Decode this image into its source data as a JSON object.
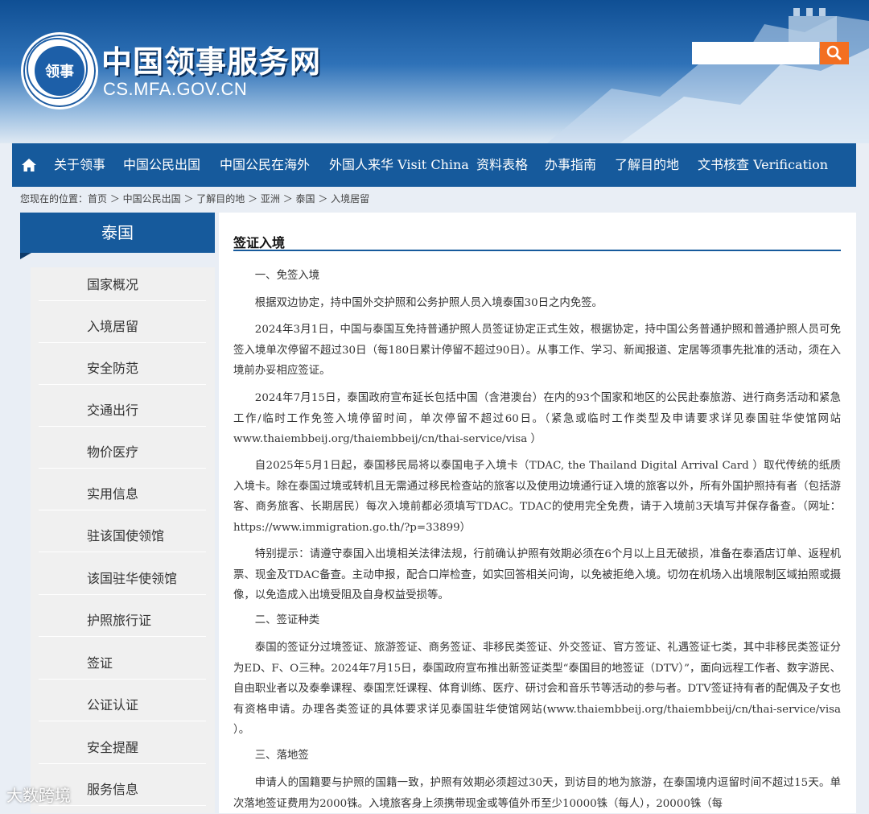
{
  "header": {
    "seal_text": "领事",
    "title": "中国领事服务网",
    "url": "CS.MFA.GOV.CN"
  },
  "nav": {
    "items": [
      "关于领事",
      "中国公民出国",
      "中国公民在海外",
      "外国人来华 Visit China",
      "资料表格",
      "办事指南",
      "了解目的地",
      "文书核查 Verification"
    ]
  },
  "breadcrumb": "您现在的位置：首页 ＞ 中国公民出国 ＞ 了解目的地 ＞ 亚洲 ＞ 泰国 ＞ 入境居留",
  "sidebar": {
    "title": "泰国",
    "items": [
      "国家概况",
      "入境居留",
      "安全防范",
      "交通出行",
      "物价医疗",
      "实用信息",
      "驻该国使领馆",
      "该国驻华使领馆",
      "护照旅行证",
      "签证",
      "公证认证",
      "安全提醒",
      "服务信息"
    ]
  },
  "content": {
    "title": "签证入境",
    "paragraphs": [
      "一、免签入境",
      "根据双边协定，持中国外交护照和公务护照人员入境泰国30日之内免签。",
      "2024年3月1日，中国与泰国互免持普通护照人员签证协定正式生效，根据协定，持中国公务普通护照和普通护照人员可免签入境单次停留不超过30日（每180日累计停留不超过90日）。从事工作、学习、新闻报道、定居等须事先批准的活动，须在入境前办妥相应签证。",
      "2024年7月15日，泰国政府宣布延长包括中国（含港澳台）在内的93个国家和地区的公民赴泰旅游、进行商务活动和紧急工作/临时工作免签入境停留时间，单次停留不超过60日。（紧急或临时工作类型及申请要求详见泰国驻华使馆网站www.thaiembbeij.org/thaiembbeij/cn/thai-service/visa ）",
      "自2025年5月1日起，泰国移民局将以泰国电子入境卡（TDAC, the Thailand Digital Arrival Card ）取代传统的纸质入境卡。除在泰国过境或转机且无需通过移民检查站的旅客以及使用边境通行证入境的旅客以外，所有外国护照持有者（包括游客、商务旅客、长期居民）每次入境前都必须填写TDAC。TDAC的使用完全免费，请于入境前3天填写并保存备查。（网址：https://www.immigration.go.th/?p=33899）",
      "特别提示：请遵守泰国入出境相关法律法规，行前确认护照有效期必须在6个月以上且无破损，准备在泰酒店订单、返程机票、现金及TDAC备查。主动申报，配合口岸检查，如实回答相关问询，以免被拒绝入境。切勿在机场入出境限制区域拍照或摄像，以免造成入出境受阻及自身权益受损等。",
      "二、签证种类",
      "泰国的签证分过境签证、旅游签证、商务签证、非移民类签证、外交签证、官方签证、礼遇签证七类，其中非移民类签证分为ED、F、O三种。2024年7月15日，泰国政府宣布推出新签证类型“泰国目的地签证（DTV）”，面向远程工作者、数字游民、自由职业者以及泰拳课程、泰国烹饪课程、体育训练、医疗、研讨会和音乐节等活动的参与者。DTV签证持有者的配偶及子女也有资格申请。办理各类签证的具体要求详见泰国驻华使馆网站(www.thaiembbeij.org/thaiembbeij/cn/thai-service/visa ）。",
      "三、落地签",
      "申请人的国籍要与护照的国籍一致，护照有效期必须超过30天，到访目的地为旅游，在泰国境内逗留时间不超过15天。单次落地签证费用为2000铢。入境旅客身上须携带现金或等值外币至少10000铢（每人），20000铢（每"
    ]
  },
  "watermark": "大数跨境"
}
